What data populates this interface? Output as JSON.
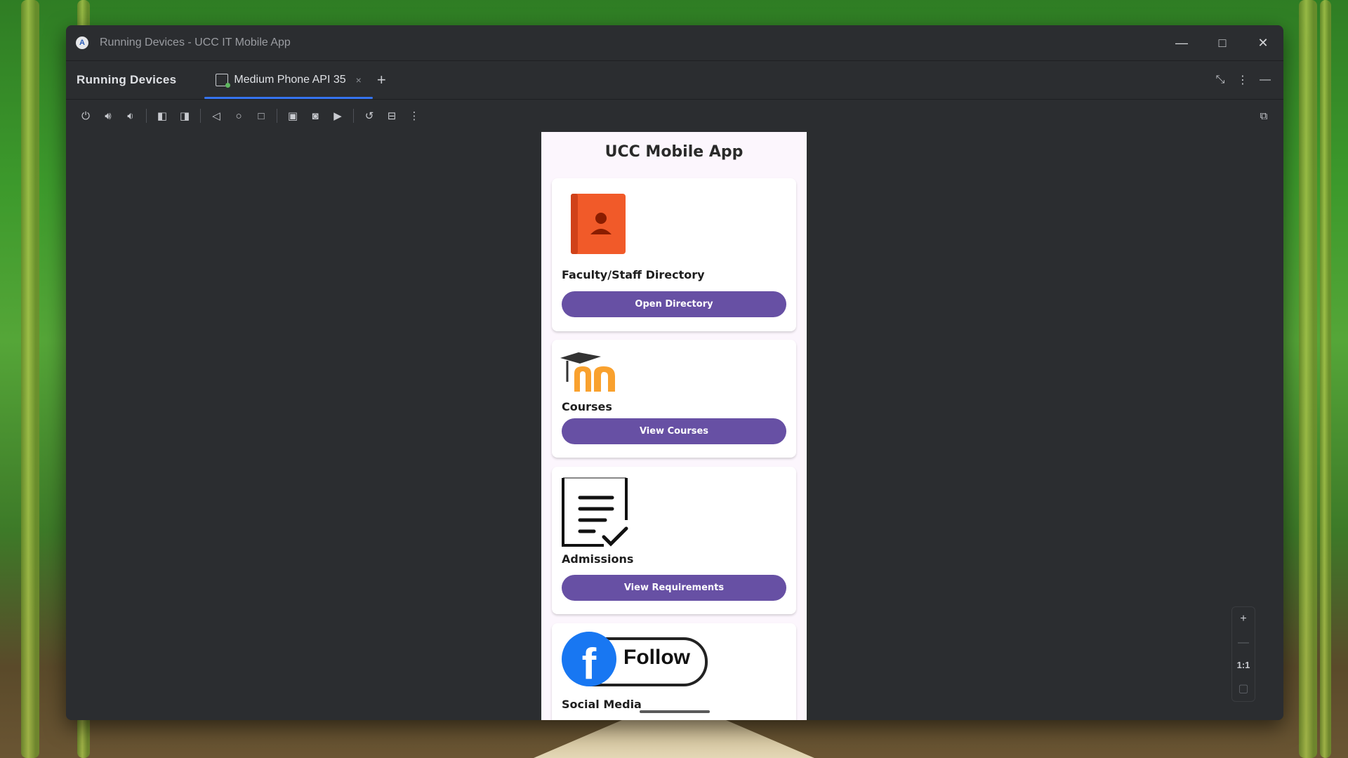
{
  "window": {
    "title": "Running Devices - UCC IT Mobile App",
    "app_icon": "android-studio-icon",
    "controls": [
      "minimize-icon",
      "maximize-icon",
      "close-icon"
    ]
  },
  "tabs": {
    "panel_title": "Running Devices",
    "active_tab_label": "Medium Phone API 35",
    "add_label": "+",
    "close_label": "×"
  },
  "toolbar": {
    "icons": [
      "power-icon",
      "volume-up-icon",
      "volume-down-icon",
      "rotate-left-icon",
      "rotate-right-icon",
      "back-icon",
      "home-icon",
      "overview-icon",
      "device-mirror-icon",
      "screenshot-icon",
      "record-icon",
      "reset-icon",
      "snapshot-icon",
      "more-icon"
    ]
  },
  "app": {
    "title": "UCC Mobile App",
    "cards": [
      {
        "label": "Faculty/Staff Directory",
        "button": "Open Directory",
        "icon": "contact-book-icon"
      },
      {
        "label": "Courses",
        "button": "View Courses",
        "icon": "moodle-logo-icon"
      },
      {
        "label": "Admissions",
        "button": "View Requirements",
        "icon": "checklist-document-icon"
      },
      {
        "label": "Social Media",
        "icon": "facebook-follow-icon",
        "follow_text": "Follow"
      }
    ]
  },
  "zoom": {
    "plus": "+",
    "minus": "—",
    "ratio": "1:1"
  }
}
